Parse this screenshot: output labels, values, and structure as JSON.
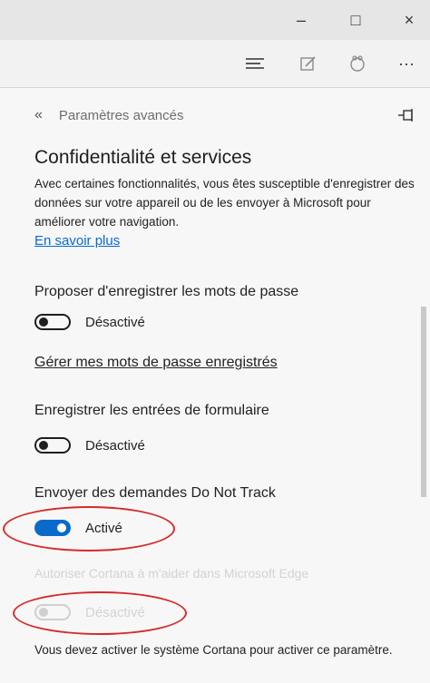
{
  "window": {
    "minimize": "–",
    "maximize": "□",
    "close": "×"
  },
  "toolbar": {
    "more": "···"
  },
  "header": {
    "back": "«",
    "title": "Paramètres avancés"
  },
  "section": {
    "title": "Confidentialité et services",
    "description": "Avec certaines fonctionnalités, vous êtes susceptible d'enregistrer des données sur votre appareil ou de les envoyer à Microsoft pour améliorer votre navigation.",
    "learn_more": "En savoir plus"
  },
  "settings": {
    "passwords": {
      "label": "Proposer d'enregistrer les mots de passe",
      "state": "Désactivé",
      "manage_link": "Gérer mes mots de passe enregistrés"
    },
    "forms": {
      "label": "Enregistrer les entrées de formulaire",
      "state": "Désactivé"
    },
    "dnt": {
      "label": "Envoyer des demandes Do Not Track",
      "state": "Activé"
    },
    "cortana": {
      "label": "Autoriser Cortana à m'aider dans Microsoft Edge",
      "state": "Désactivé"
    }
  },
  "footnote": "Vous devez activer le système Cortana pour activer ce paramètre.",
  "colors": {
    "accent": "#0a6acb",
    "annotation": "#d52a2a"
  }
}
